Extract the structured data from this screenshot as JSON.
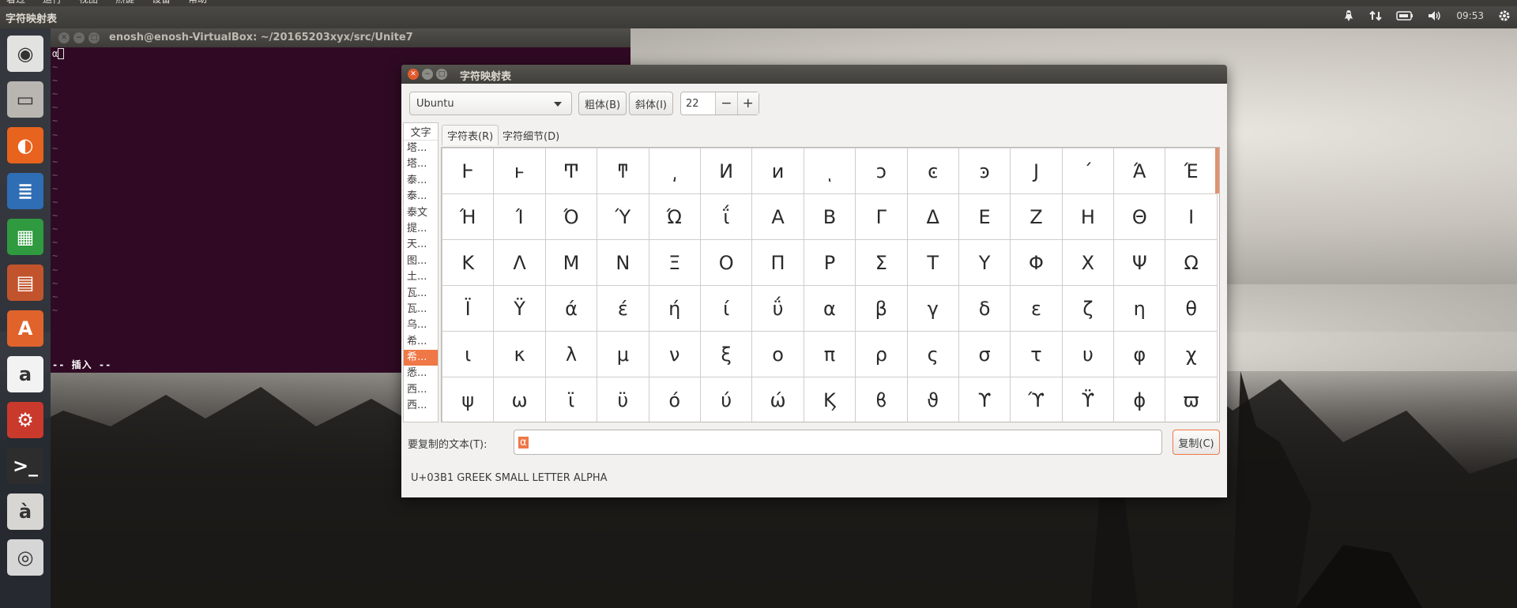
{
  "top_menu": [
    "着过",
    "运行",
    "视图",
    "热键",
    "设备",
    "帮助"
  ],
  "panel": {
    "app_title": "字符映射表",
    "clock": "09:53"
  },
  "launcher": [
    {
      "name": "ubuntu-dash-icon",
      "color": "#e2e2e0",
      "glyph": "◉"
    },
    {
      "name": "files-icon",
      "color": "#b9b6b1",
      "glyph": "▭"
    },
    {
      "name": "firefox-icon",
      "color": "#e8631d",
      "glyph": "◐"
    },
    {
      "name": "writer-icon",
      "color": "#2f6db5",
      "glyph": "≣"
    },
    {
      "name": "calc-icon",
      "color": "#2f9a3f",
      "glyph": "▦"
    },
    {
      "name": "impress-icon",
      "color": "#c2542d",
      "glyph": "▤"
    },
    {
      "name": "software-center-icon",
      "color": "#e0632c",
      "glyph": "A"
    },
    {
      "name": "amazon-icon",
      "color": "#f2f2f2",
      "glyph": "a"
    },
    {
      "name": "settings-icon",
      "color": "#c93a2c",
      "glyph": "⚙"
    },
    {
      "name": "terminal-icon",
      "color": "#2d2d2d",
      "glyph": ">_"
    },
    {
      "name": "charmap-icon",
      "color": "#d8d6d2",
      "glyph": "à"
    },
    {
      "name": "dvd-icon",
      "color": "#d6d6d6",
      "glyph": "◎"
    }
  ],
  "terminal": {
    "title": "enosh@enosh-VirtualBox: ~/20165203xyx/src/Unite7",
    "first_char": "α",
    "tilde": "~",
    "mode": "-- 插入 --"
  },
  "charmap": {
    "title": "字符映射表",
    "font": "Ubuntu",
    "bold_label": "粗体(B)",
    "italic_label": "斜体(I)",
    "size": "22",
    "minus": "−",
    "plus": "+",
    "scripts_header": "文字",
    "scripts": [
      "塔...",
      "塔...",
      "泰...",
      "泰...",
      "泰文",
      "提...",
      "天...",
      "图...",
      "土...",
      "瓦...",
      "瓦...",
      "乌...",
      "希...",
      "希...",
      "悉...",
      "西...",
      "西..."
    ],
    "selected_script_index": 13,
    "tab_table": "字符表(R)",
    "tab_details": "字符细节(D)",
    "grid": [
      [
        "Ͱ",
        "ͱ",
        "Ͳ",
        "ͳ",
        "͵",
        "Ͷ",
        "ͷ",
        "ͺ",
        "ͻ",
        "ͼ",
        "ͽ",
        "Ϳ",
        "΄",
        "Ά",
        "Έ"
      ],
      [
        "Ή",
        "Ί",
        "Ό",
        "Ύ",
        "Ώ",
        "ΐ",
        "Α",
        "Β",
        "Γ",
        "Δ",
        "Ε",
        "Ζ",
        "Η",
        "Θ",
        "Ι"
      ],
      [
        "Κ",
        "Λ",
        "Μ",
        "Ν",
        "Ξ",
        "Ο",
        "Π",
        "Ρ",
        "Σ",
        "Τ",
        "Υ",
        "Φ",
        "Χ",
        "Ψ",
        "Ω"
      ],
      [
        "Ϊ",
        "Ϋ",
        "ά",
        "έ",
        "ή",
        "ί",
        "ΰ",
        "α",
        "β",
        "γ",
        "δ",
        "ε",
        "ζ",
        "η",
        "θ"
      ],
      [
        "ι",
        "κ",
        "λ",
        "μ",
        "ν",
        "ξ",
        "ο",
        "π",
        "ρ",
        "ς",
        "σ",
        "τ",
        "υ",
        "φ",
        "χ"
      ],
      [
        "ψ",
        "ω",
        "ϊ",
        "ϋ",
        "ό",
        "ύ",
        "ώ",
        "Ϗ",
        "ϐ",
        "ϑ",
        "ϒ",
        "ϓ",
        "ϔ",
        "ϕ",
        "ϖ"
      ]
    ],
    "copy_label": "要复制的文本(T):",
    "copy_value": "α",
    "copy_button": "复制(C)",
    "status": "U+03B1 GREEK SMALL LETTER ALPHA"
  },
  "colors": {
    "panel": "#3c3b37",
    "terminal_bg": "#300a24",
    "accent": "#f07746"
  }
}
